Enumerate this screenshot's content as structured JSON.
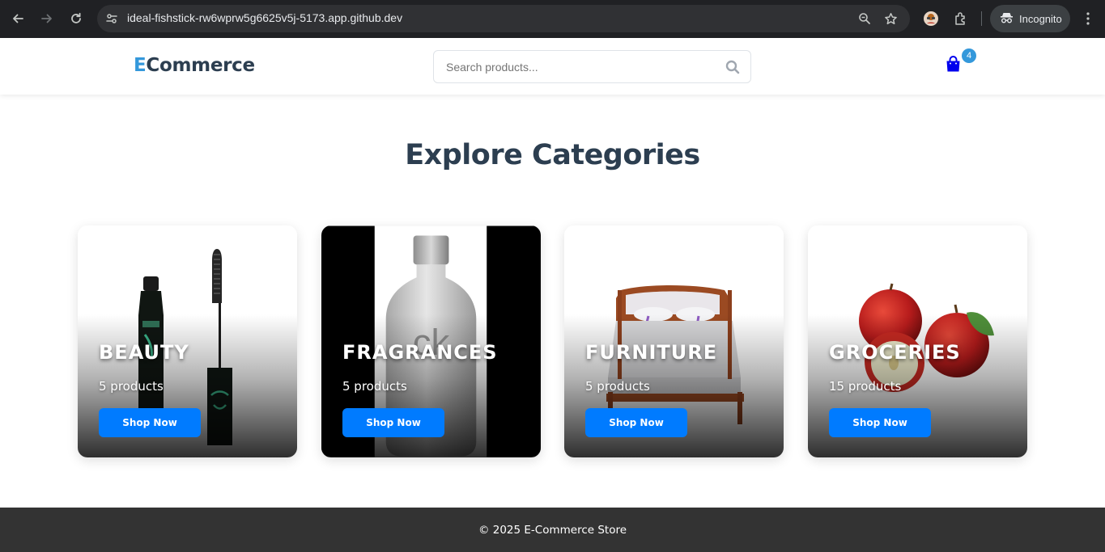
{
  "browser": {
    "url": "ideal-fishstick-rw6wprw5g6625v5j-5173.app.github.dev",
    "incognito_label": "Incognito",
    "icons": [
      "back-arrow-icon",
      "forward-arrow-icon",
      "reload-icon",
      "site-info-icon",
      "zoom-icon",
      "bookmark-star-icon",
      "profile-avatar-icon",
      "extensions-icon",
      "incognito-icon",
      "more-vert-icon"
    ]
  },
  "header": {
    "logo_accent": "E",
    "logo_rest": "Commerce",
    "search_placeholder": "Search products...",
    "cart_count": "4",
    "colors": {
      "logo_accent": "#3498db",
      "logo_text": "#2c3e50",
      "badge": "#3498db",
      "cart_icon": "#0000ee"
    }
  },
  "main": {
    "title": "Explore Categories",
    "categories": [
      {
        "name": "BEAUTY",
        "count_label": "5 products",
        "button_label": "Shop Now",
        "image_icon": "mascara-icon"
      },
      {
        "name": "FRAGRANCES",
        "count_label": "5 products",
        "button_label": "Shop Now",
        "image_icon": "perfume-bottle-icon",
        "image_text": "ck"
      },
      {
        "name": "FURNITURE",
        "count_label": "5 products",
        "button_label": "Shop Now",
        "image_icon": "bed-icon"
      },
      {
        "name": "GROCERIES",
        "count_label": "15 products",
        "button_label": "Shop Now",
        "image_icon": "apples-icon"
      }
    ],
    "colors": {
      "button": "#007bff",
      "title": "#2c3e50"
    }
  },
  "footer": {
    "text": "© 2025 E-Commerce Store",
    "background": "#333333"
  }
}
